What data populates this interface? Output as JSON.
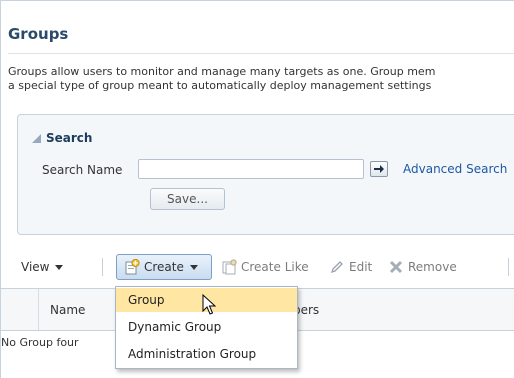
{
  "page": {
    "title": "Groups",
    "description_line1": "Groups allow users to monitor and manage many targets as one. Group mem",
    "description_line2": "a special type of group meant to automatically deploy management settings"
  },
  "search": {
    "header": "Search",
    "name_label": "Search Name",
    "name_value": "",
    "advanced_link": "Advanced Search",
    "save_label": "Save..."
  },
  "toolbar": {
    "view_label": "View",
    "create_label": "Create",
    "create_like_label": "Create Like",
    "edit_label": "Edit",
    "remove_label": "Remove"
  },
  "table": {
    "columns": [
      "Name",
      "bers"
    ],
    "empty_message": "No Group four"
  },
  "create_menu": {
    "items": [
      "Group",
      "Dynamic Group",
      "Administration Group"
    ],
    "highlighted_index": 0
  },
  "icons": {
    "go": "arrow-right-icon",
    "create": "create-group-icon",
    "create_like": "create-like-icon",
    "edit": "pencil-icon",
    "remove": "remove-x-icon"
  },
  "colors": {
    "title": "#2b4a6b",
    "link": "#1d57a4",
    "menu_highlight": "#ffe6a3",
    "create_button_top": "#e9f2fb",
    "create_button_bottom": "#c9dcf0"
  }
}
